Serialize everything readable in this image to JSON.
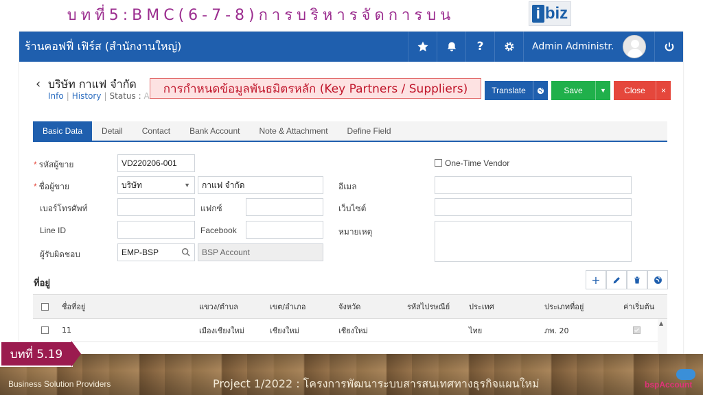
{
  "slide": {
    "title": "บทที่5:BMC(6-7-8)การบริหารจัดการบน",
    "logo_i": "i",
    "logo_rest": "biz"
  },
  "topbar": {
    "shop_name": "ร้านคอฟฟี่ เฟิร์ส (สำนักงานใหญ่)",
    "user_name": "Admin Administr...",
    "icons": [
      "star-icon",
      "bell-icon",
      "help-icon",
      "gear-icon",
      "power-icon"
    ],
    "help_glyph": "?"
  },
  "header": {
    "company": "บริษัท กาแฟ จำกัด",
    "link_info": "Info",
    "link_history": "History",
    "status_label": "Status :",
    "status_value": "Active",
    "annotation": "การกำหนดข้อมูลพันธมิตรหลัก (Key Partners / Suppliers)"
  },
  "buttons": {
    "translate": "Translate",
    "save": "Save",
    "close": "Close"
  },
  "tabs": [
    "Basic Data",
    "Detail",
    "Contact",
    "Bank Account",
    "Note & Attachment",
    "Define Field"
  ],
  "form": {
    "vendor_code_label": "รหัสผู้ขาย",
    "vendor_code": "VD220206-001",
    "vendor_name_label": "ชื่อผู้ขาย",
    "prefix": "บริษัท",
    "vendor_name": "กาแฟ จำกัด",
    "phone_label": "เบอร์โทรศัพท์",
    "fax_label": "แฟกซ์",
    "line_label": "Line ID",
    "facebook_label": "Facebook",
    "owner_label": "ผู้รับผิดชอบ",
    "owner_code": "EMP-BSP",
    "owner_name": "BSP Account",
    "one_time_vendor": "One-Time Vendor",
    "email_label": "อีเมล",
    "website_label": "เว็บไซต์",
    "note_label": "หมายเหตุ"
  },
  "address": {
    "title": "ที่อยู่",
    "actions": [
      "add-icon",
      "edit-icon",
      "delete-icon",
      "globe-icon"
    ],
    "add_glyph": "+",
    "columns": [
      "ชื่อที่อยู่",
      "แขวง/ตำบล",
      "เขต/อำเภอ",
      "จังหวัด",
      "รหัสไปรษณีย์",
      "ประเทศ",
      "ประเภทที่อยู่",
      "ค่าเริ่มต้น"
    ],
    "rows": [
      {
        "name": "11",
        "subdistrict": "เมืองเชียงใหม่",
        "district": "เชียงใหม่",
        "province": "เชียงใหม่",
        "postcode": "",
        "country": "ไทย",
        "type": "ภพ. 20",
        "default": true
      }
    ]
  },
  "footer": {
    "chapter": "บทที่ 5.19",
    "left_text": "Business Solution Providers",
    "project": "Project 1/2022 : โครงการพัฒนาระบบสารสนเทศทางธุรกิจแผนใหม่",
    "logo_text": "bspAccount"
  },
  "colors": {
    "brand_blue": "#1f5fae",
    "save_green": "#20b04b",
    "close_red": "#e5473c",
    "title_purple": "#9b2d8f",
    "chapter_magenta": "#9b1b4f"
  }
}
